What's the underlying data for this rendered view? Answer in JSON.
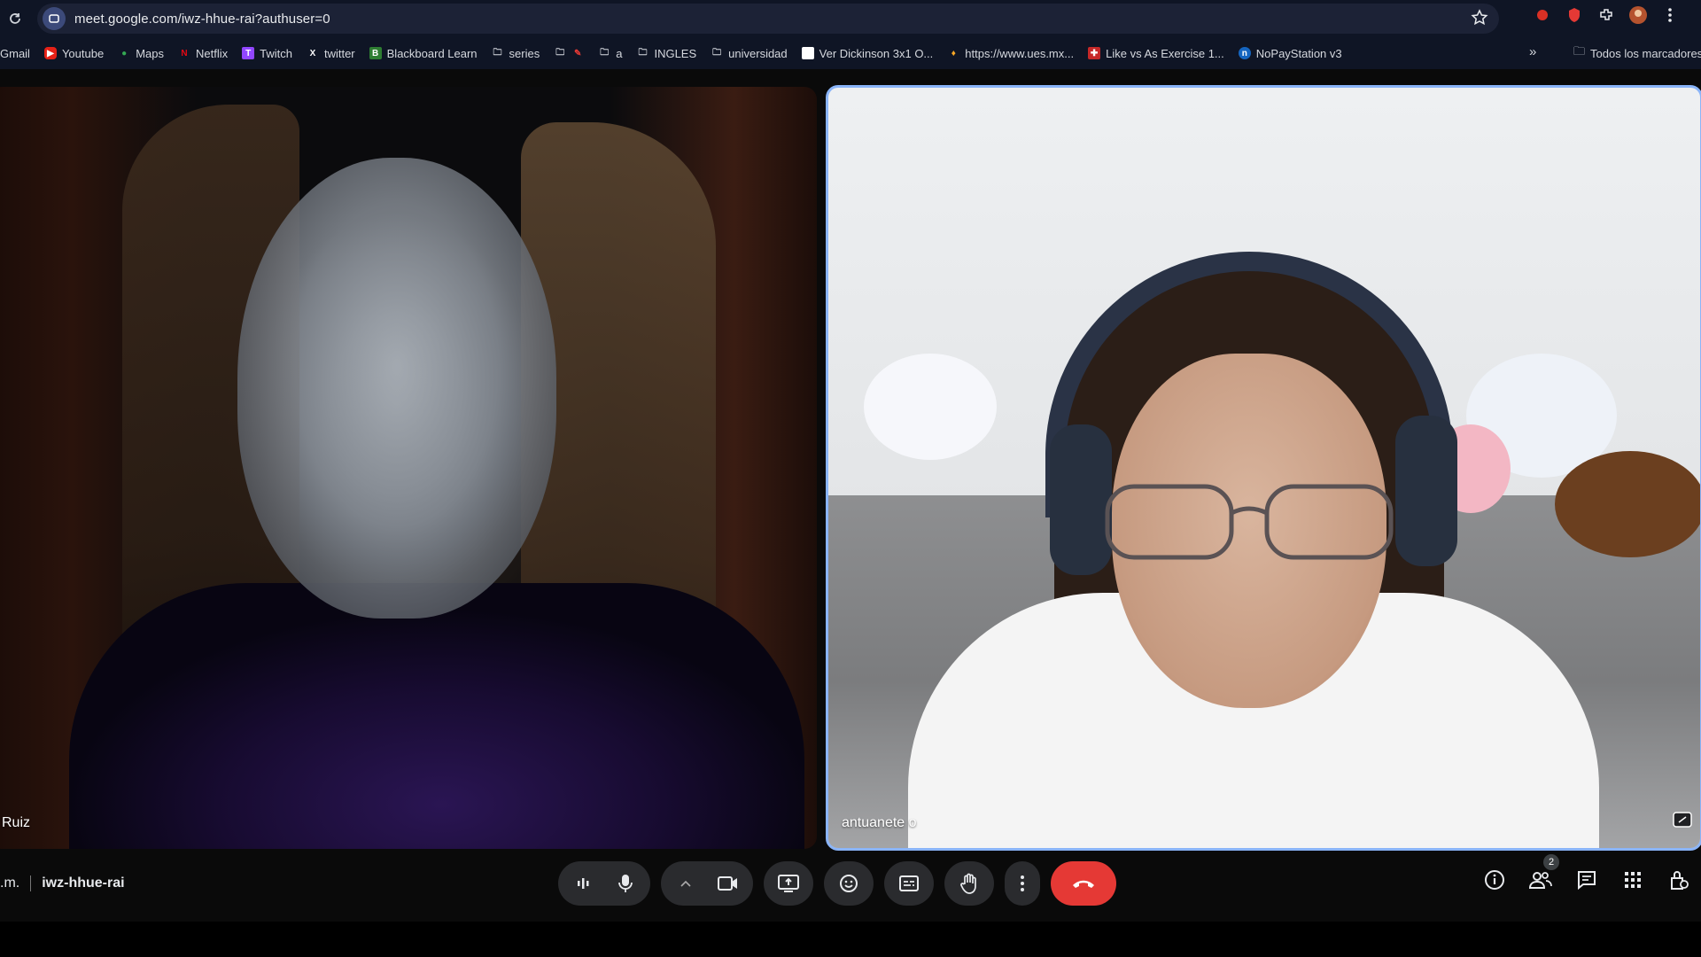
{
  "browser": {
    "url": "meet.google.com/iwz-hhue-rai?authuser=0",
    "bookmarks": [
      {
        "label": "Gmail",
        "icon": "gmail-icon"
      },
      {
        "label": "Youtube",
        "icon": "youtube-icon"
      },
      {
        "label": "Maps",
        "icon": "maps-icon"
      },
      {
        "label": "Netflix",
        "icon": "netflix-icon"
      },
      {
        "label": "Twitch",
        "icon": "twitch-icon"
      },
      {
        "label": "twitter",
        "icon": "x-icon"
      },
      {
        "label": "Blackboard Learn",
        "icon": "blackboard-icon"
      },
      {
        "label": "series",
        "icon": "folder-icon"
      },
      {
        "label": "",
        "icon": "folder-icon"
      },
      {
        "label": "a",
        "icon": "folder-icon"
      },
      {
        "label": "INGLES",
        "icon": "folder-icon"
      },
      {
        "label": "universidad",
        "icon": "folder-icon"
      },
      {
        "label": "Ver Dickinson 3x1 O...",
        "icon": "page-icon"
      },
      {
        "label": "https://www.ues.mx...",
        "icon": "flame-icon"
      },
      {
        "label": "Like vs As Exercise 1...",
        "icon": "flag-icon"
      },
      {
        "label": "NoPayStation v3",
        "icon": "nps-icon"
      }
    ],
    "bookmarks_more": "»",
    "all_bookmarks": "Todos los marcadores"
  },
  "meet": {
    "participants": [
      {
        "name": "Ruiz"
      },
      {
        "name": "antuanete o"
      }
    ],
    "time_fragment": ".m.",
    "meeting_code": "iwz-hhue-rai",
    "people_count": "2"
  },
  "colors": {
    "accent": "#8ab4f8",
    "end_call": "#e53935",
    "toolbar_button": "#2a2b2e"
  }
}
